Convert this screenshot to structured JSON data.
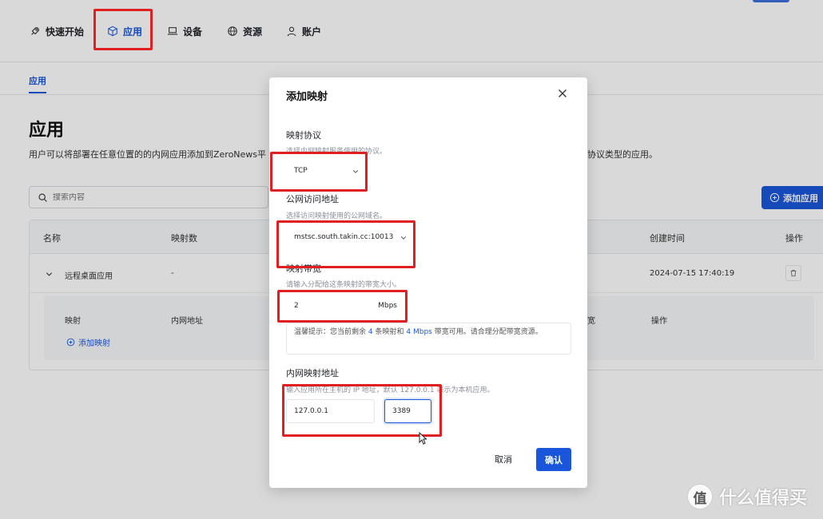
{
  "nav": {
    "items": [
      {
        "label": "快速开始",
        "icon": "rocket-icon"
      },
      {
        "label": "应用",
        "icon": "cube-icon",
        "active": true
      },
      {
        "label": "设备",
        "icon": "laptop-icon"
      },
      {
        "label": "资源",
        "icon": "globe-icon"
      },
      {
        "label": "账户",
        "icon": "user-icon"
      }
    ]
  },
  "subnav": {
    "tab": "应用"
  },
  "page": {
    "title": "应用",
    "description": "用户可以将部署在任意位置的的内网应用添加到ZeroNews平",
    "description_tail": "协议类型的应用。",
    "search_placeholder": "搜索内容",
    "add_app_label": "添加应用"
  },
  "table": {
    "columns": [
      "名称",
      "映射数",
      "创建时间",
      "操作"
    ],
    "rows": [
      {
        "name": "远程桌面应用",
        "mappings": "-",
        "created": "2024-07-15 17:40:19"
      }
    ],
    "sub_columns": [
      "映射",
      "内网地址",
      "宽",
      "操作"
    ],
    "add_mapping_label": "添加映射"
  },
  "modal": {
    "title": "添加映射",
    "protocol": {
      "label": "映射协议",
      "help": "选择内网映射服务使用的协议。",
      "value": "TCP"
    },
    "public_address": {
      "label": "公网访问地址",
      "help": "选择访问映射使用的公网域名。",
      "value": "mstsc.south.takin.cc:10013"
    },
    "bandwidth": {
      "label": "映射带宽",
      "help": "请输入分配给这条映射的带宽大小。",
      "value": "2",
      "unit": "Mbps"
    },
    "tip": {
      "prefix": "温馨提示：您当前剩余",
      "remaining_mappings": "4",
      "middle": "条映射和",
      "remaining_bandwidth": "4 Mbps",
      "suffix": "带宽可用。请合理分配带宽资源。"
    },
    "internal_address": {
      "label": "内网映射地址",
      "help": "输入应用所在主机的 IP 地址，默认 127.0.0.1 表示为本机应用。",
      "ip": "127.0.0.1",
      "port": "3389"
    },
    "cancel_label": "取消",
    "confirm_label": "确认"
  },
  "watermark": {
    "logo": "值",
    "text": "什么值得买"
  },
  "colors": {
    "primary": "#1a56db",
    "highlight": "#e02020"
  }
}
